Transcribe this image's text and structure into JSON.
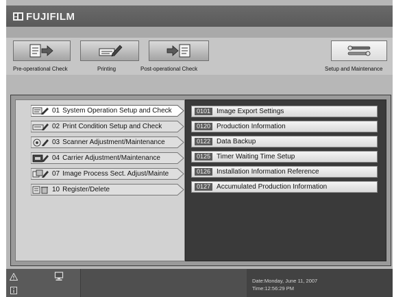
{
  "brand": {
    "name": "FUJIFILM"
  },
  "toolbar": {
    "buttons": [
      {
        "label": "Pre-operational Check",
        "icon": "clipboard-arrow-icon"
      },
      {
        "label": "Printing",
        "icon": "print-pencil-icon"
      },
      {
        "label": "Post-operational Check",
        "icon": "arrow-clipboard-icon"
      },
      {
        "label": "Setup and Maintenance",
        "icon": "wrench-tools-icon",
        "active": true
      }
    ]
  },
  "menu": {
    "items": [
      {
        "number": "01",
        "label": "System Operation Setup and Check",
        "active": true
      },
      {
        "number": "02",
        "label": "Print Condition Setup and Check"
      },
      {
        "number": "03",
        "label": "Scanner Adjustment/Maintenance"
      },
      {
        "number": "04",
        "label": "Carrier Adjustment/Maintenance"
      },
      {
        "number": "07",
        "label": "Image Process Sect. Adjust/Mainte"
      },
      {
        "number": "10",
        "label": "Register/Delete"
      }
    ]
  },
  "submenu": {
    "items": [
      {
        "code": "0101",
        "label": "Image Export Settings"
      },
      {
        "code": "0120",
        "label": "Production Information"
      },
      {
        "code": "0122",
        "label": "Data Backup"
      },
      {
        "code": "0125",
        "label": "Timer Waiting Time Setup"
      },
      {
        "code": "0126",
        "label": "Installation Information Reference"
      },
      {
        "code": "0127",
        "label": "Accumulated Production Information"
      }
    ]
  },
  "status": {
    "date": "Date:Monday, June 11, 2007",
    "time": "Time:12:56:29 PM"
  }
}
